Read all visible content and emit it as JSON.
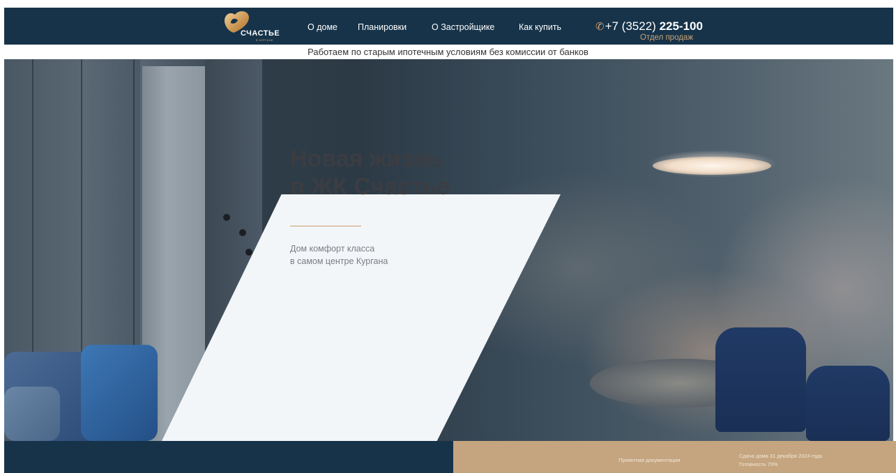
{
  "header": {
    "logo": {
      "name": "СЧАСТЬЕ",
      "subtitle": "В КУРГАНЕ",
      "icon": "heart-logo-icon"
    },
    "nav": [
      {
        "label": "О доме"
      },
      {
        "label": "Планировки"
      },
      {
        "label": "О Застройщике"
      },
      {
        "label": "Как купить"
      }
    ],
    "phone": {
      "icon": "phone-icon",
      "prefix": "+7 (3522) ",
      "number": "225-100",
      "caption": "Отдел продаж"
    }
  },
  "promo": {
    "text": "Работаем по старым ипотечным условиям без комиссии от банков"
  },
  "hero": {
    "title_line1": "Новая жизнь",
    "title_line2": "в ЖК Счастье",
    "subtitle_line1": "Дом комфорт класса",
    "subtitle_line2": "в самом центре Кургана"
  },
  "footer_bar": {
    "docs_label": "Проектная документация",
    "deadline_line1": "Сдача дома 31 декабря 2024 года",
    "deadline_line2": "Готовность 70%"
  },
  "colors": {
    "navy": "#163349",
    "gold": "#c4a57f",
    "accent": "#d2a06e"
  }
}
